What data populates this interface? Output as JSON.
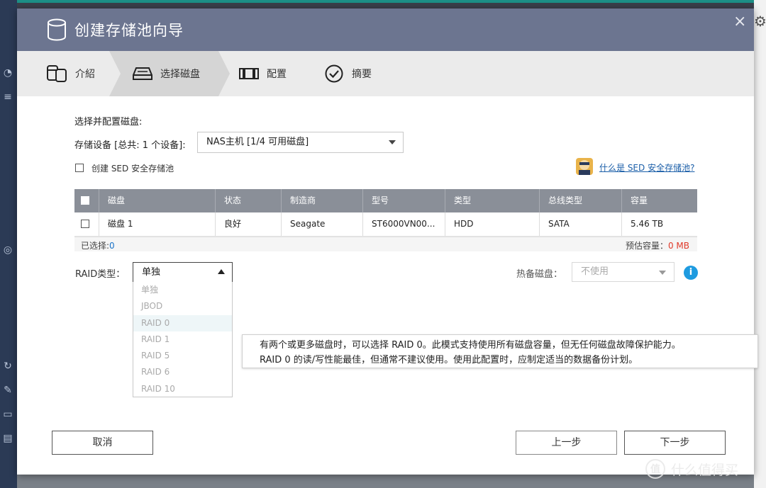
{
  "dialog": {
    "title": "创建存储池向导",
    "close_glyph": "×"
  },
  "steps": [
    {
      "label": "介紹",
      "icon": "storage-pool-icon"
    },
    {
      "label": "选择磁盘",
      "icon": "disk-icon"
    },
    {
      "label": "配置",
      "icon": "config-bar-icon"
    },
    {
      "label": "摘要",
      "icon": "check-circle-icon"
    }
  ],
  "form": {
    "section_label": "选择并配置磁盘:",
    "device_label": "存储设备 [总共: 1 个设备]:",
    "device_value": "NAS主机 [1/4 可用磁盘]",
    "sed_checkbox_label": "创建 SED 安全存储池",
    "sed_link": "什么是 SED 安全存储池?"
  },
  "table": {
    "headers": [
      "磁盘",
      "状态",
      "制造商",
      "型号",
      "类型",
      "总线类型",
      "容量"
    ],
    "rows": [
      [
        "磁盘 1",
        "良好",
        "Seagate",
        "ST6000VN00...",
        "HDD",
        "SATA",
        "5.46 TB"
      ]
    ],
    "selected_label": "已选择:",
    "selected_count": "0",
    "estimated_label": "预估容量：",
    "estimated_value": "0 MB"
  },
  "raid": {
    "label": "RAID类型：",
    "value": "单独",
    "options": [
      "单独",
      "JBOD",
      "RAID 0",
      "RAID 1",
      "RAID 5",
      "RAID 6",
      "RAID 10"
    ],
    "hovered": "RAID 0"
  },
  "hot_spare": {
    "label": "热备磁盘：",
    "value": "不使用"
  },
  "tooltip": {
    "line1": "有两个或更多磁盘时，可以选择 RAID 0。此模式支持使用所有磁盘容量，但无任何磁盘故障保护能力。",
    "line2": "RAID 0 的读/写性能最佳，但通常不建议使用。使用此配置时，应制定适当的数据备份计划。"
  },
  "buttons": {
    "cancel": "取消",
    "prev": "上一步",
    "next": "下一步"
  },
  "watermark": {
    "badge": "值",
    "text": "什么值得买"
  },
  "colors": {
    "titlebar": "#6c7590",
    "table_header": "#8a8f98",
    "link": "#1a5ea8",
    "info": "#1e9be0",
    "estimate_red": "#e03a2a"
  }
}
